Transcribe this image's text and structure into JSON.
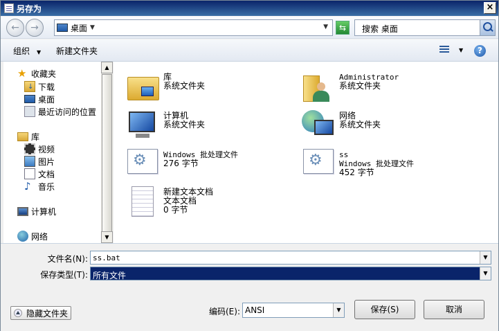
{
  "window": {
    "title": "另存为",
    "close": "×"
  },
  "nav": {
    "back": "←",
    "forward": "→",
    "address": "桌面",
    "search_placeholder": "搜索 桌面"
  },
  "toolbar": {
    "organize": "组织",
    "new_folder": "新建文件夹"
  },
  "sidebar": {
    "favorites": "收藏夹",
    "downloads": "下载",
    "desktop": "桌面",
    "recent": "最近访问的位置",
    "libraries": "库",
    "videos": "视频",
    "pictures": "图片",
    "documents": "文档",
    "music": "音乐",
    "computer": "计算机",
    "network": "网络"
  },
  "files": [
    {
      "name": "库",
      "type": "系统文件夹"
    },
    {
      "name": "Administrator",
      "type": "系统文件夹"
    },
    {
      "name": "计算机",
      "type": "系统文件夹"
    },
    {
      "name": "网络",
      "type": "系统文件夹"
    },
    {
      "name": "Windows 批处理文件",
      "type": "276 字节"
    },
    {
      "name": "ss",
      "type": "Windows 批处理文件",
      "size": "452 字节"
    },
    {
      "name": "新建文本文档",
      "type": "文本文档",
      "size": "0 字节"
    }
  ],
  "form": {
    "filename_label": "文件名(N):",
    "filename_value": "ss.bat",
    "filetype_label": "保存类型(T):",
    "filetype_value": "所有文件",
    "encoding_label": "编码(E):",
    "encoding_value": "ANSI"
  },
  "buttons": {
    "save": "保存(S)",
    "cancel": "取消",
    "hide_folders": "隐藏文件夹"
  }
}
